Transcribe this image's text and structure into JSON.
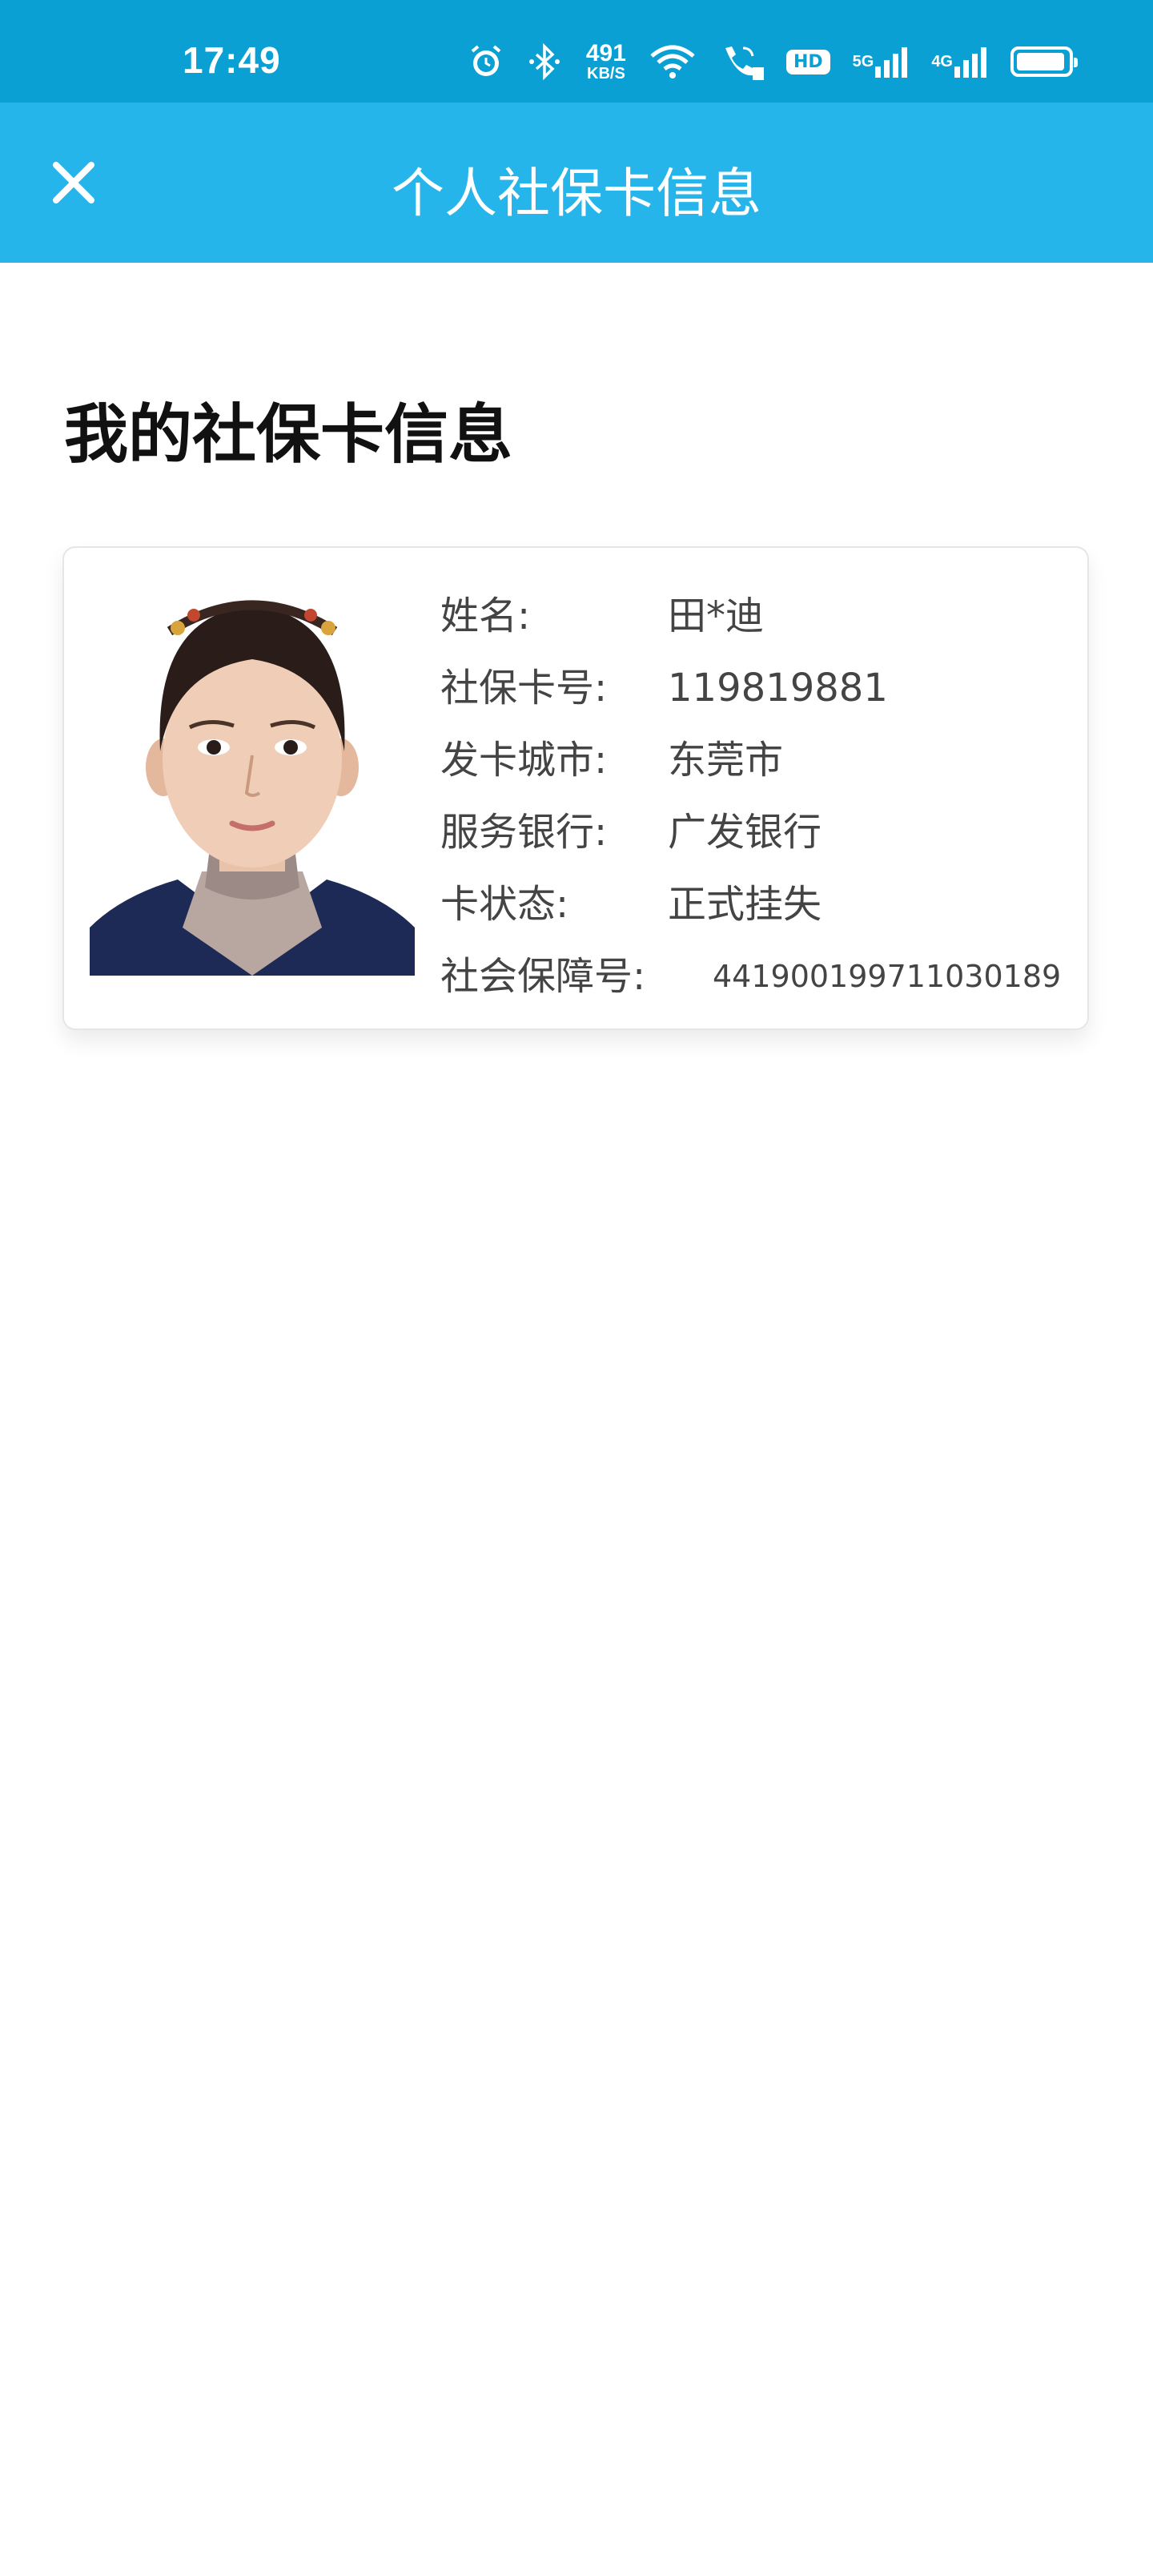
{
  "status_bar": {
    "time": "17:49",
    "net_speed_value": "491",
    "net_speed_unit": "KB/S",
    "hd_label": "HD",
    "sim1_label": "5G",
    "sim2_label": "4G",
    "icons": [
      "alarm-icon",
      "bluetooth-icon",
      "wifi-icon",
      "wifi-call-icon",
      "hd-icon",
      "signal-5g-icon",
      "signal-4g-icon",
      "battery-icon"
    ],
    "battery_level": 0.95
  },
  "app_bar": {
    "title": "个人社保卡信息",
    "close_icon": "close-icon"
  },
  "page": {
    "heading": "我的社保卡信息"
  },
  "card": {
    "photo": "id-photo",
    "rows": [
      {
        "label": "姓名:",
        "value": "田*迪"
      },
      {
        "label": "社保卡号:",
        "value": "119819881"
      },
      {
        "label": "发卡城市:",
        "value": "东莞市"
      },
      {
        "label": "服务银行:",
        "value": "广发银行"
      },
      {
        "label": "卡状态:",
        "value": "正式挂失"
      },
      {
        "label": "社会保障号:",
        "value": "441900199711030189"
      }
    ]
  },
  "colors": {
    "status_bar": "#0aa0d4",
    "app_bar": "#26b5eb",
    "background": "#ffffff"
  }
}
